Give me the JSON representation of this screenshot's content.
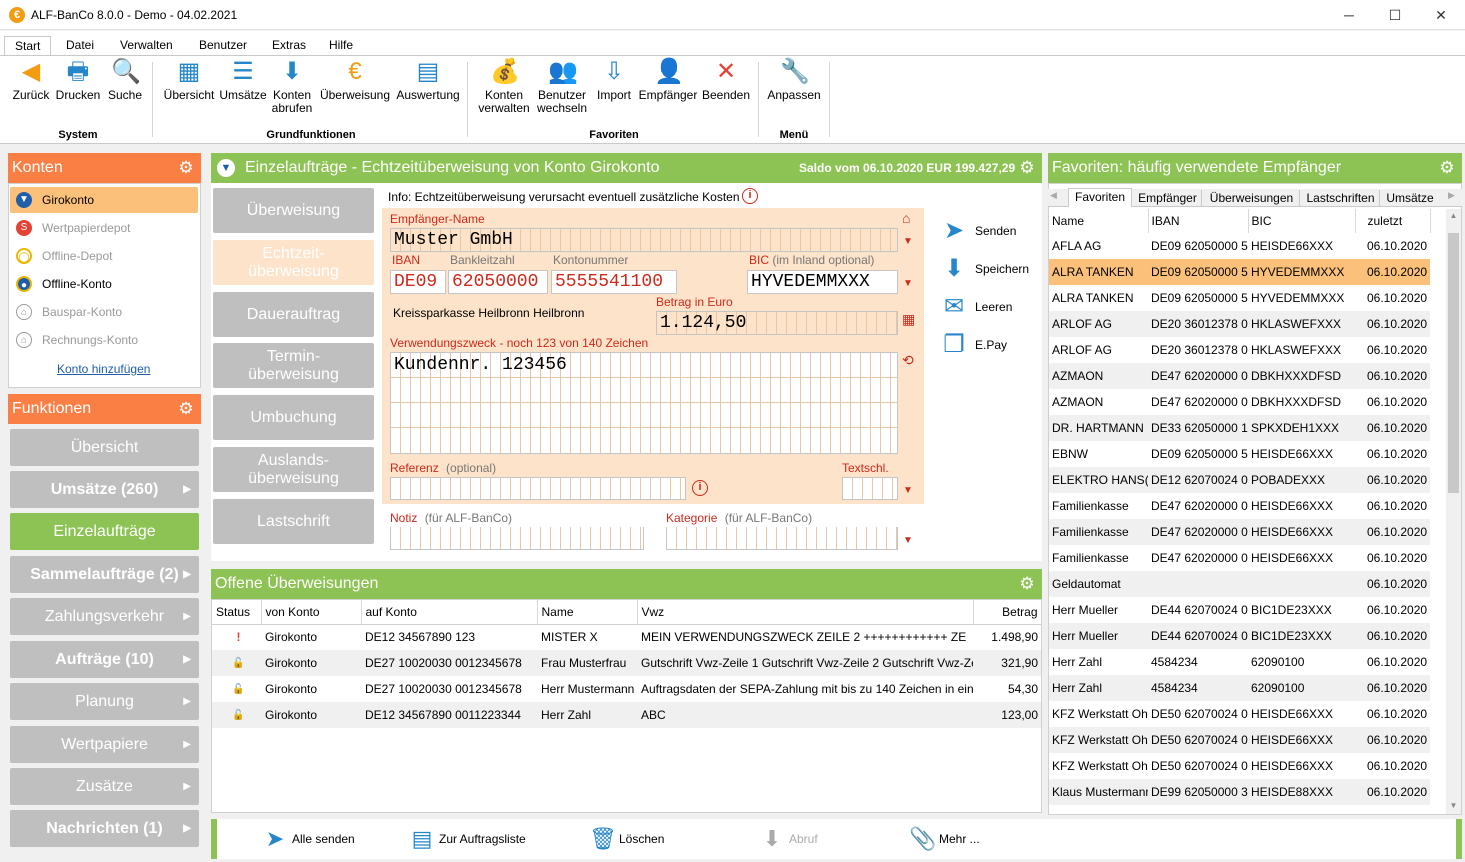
{
  "window": {
    "title": "ALF-BanCo 8.0.0 - Demo  -  04.02.2021",
    "minimize": "─",
    "maximize": "☐",
    "close": "✕"
  },
  "menu": {
    "tabs": [
      "Start",
      "Datei",
      "Verwalten",
      "Benutzer",
      "Extras",
      "Hilfe"
    ]
  },
  "ribbon": {
    "buttons": [
      {
        "label": "Zurück",
        "icon": "arrow-left-icon",
        "glyph": "◀"
      },
      {
        "label": "Drucken",
        "icon": "printer-icon",
        "glyph": "🖶"
      },
      {
        "label": "Suche",
        "icon": "search-icon",
        "glyph": "🔍"
      },
      {
        "label": "Übersicht",
        "icon": "overview-icon",
        "glyph": "▦"
      },
      {
        "label": "Umsätze",
        "icon": "list-icon",
        "glyph": "☰"
      },
      {
        "label": "Konten\nabrufen",
        "icon": "download-icon",
        "glyph": "⬇"
      },
      {
        "label": "Überweisung",
        "icon": "euro-icon",
        "glyph": "€"
      },
      {
        "label": "Auswertung",
        "icon": "document-icon",
        "glyph": "▤"
      },
      {
        "label": "Konten\nverwalten",
        "icon": "money-bag-icon",
        "glyph": "💰"
      },
      {
        "label": "Benutzer\nwechseln",
        "icon": "users-icon",
        "glyph": "👥"
      },
      {
        "label": "Import",
        "icon": "import-icon",
        "glyph": "⇩"
      },
      {
        "label": "Empfänger",
        "icon": "recipient-icon",
        "glyph": "👤"
      },
      {
        "label": "Beenden",
        "icon": "exit-icon",
        "glyph": "✕"
      },
      {
        "label": "Anpassen",
        "icon": "tools-icon",
        "glyph": "🔧"
      }
    ],
    "groups": [
      "System",
      "Grundfunktionen",
      "Favoriten",
      "Menü"
    ]
  },
  "konten": {
    "title": "Konten",
    "items": [
      {
        "label": "Girokonto",
        "active": true,
        "color": "#1f5ea8"
      },
      {
        "label": "Wertpapierdepot",
        "active": false,
        "color": "#e34234"
      },
      {
        "label": "Offline-Depot",
        "active": false,
        "color": "#e8b600"
      },
      {
        "label": "Offline-Konto",
        "active": true,
        "color": "#1f5ea8"
      },
      {
        "label": "Bauspar-Konto",
        "active": false,
        "color": "#9a9a9a"
      },
      {
        "label": "Rechnungs-Konto",
        "active": false,
        "color": "#9a9a9a"
      }
    ],
    "add_link": "Konto hinzufügen"
  },
  "funktionen": {
    "title": "Funktionen",
    "items": [
      {
        "label": "Übersicht",
        "bold": false,
        "arrow": false,
        "active": false
      },
      {
        "label": "Umsätze (260)",
        "bold": true,
        "arrow": true,
        "active": false
      },
      {
        "label": "Einzelaufträge",
        "bold": false,
        "arrow": false,
        "active": true
      },
      {
        "label": "Sammelaufträge (2)",
        "bold": true,
        "arrow": true,
        "active": false
      },
      {
        "label": "Zahlungsverkehr",
        "bold": false,
        "arrow": true,
        "active": false
      },
      {
        "label": "Aufträge (10)",
        "bold": true,
        "arrow": true,
        "active": false
      },
      {
        "label": "Planung",
        "bold": false,
        "arrow": true,
        "active": false
      },
      {
        "label": "Wertpapiere",
        "bold": false,
        "arrow": true,
        "active": false
      },
      {
        "label": "Zusätze",
        "bold": false,
        "arrow": true,
        "active": false
      },
      {
        "label": "Nachrichten (1)",
        "bold": true,
        "arrow": true,
        "active": false
      }
    ]
  },
  "einzel": {
    "title": "Einzelaufträge - Echtzeitüberweisung von Konto Girokonto",
    "saldo": "Saldo vom 06.10.2020 EUR 199.427,29",
    "tabs": [
      "Überweisung",
      "Echtzeit-\nüberweisung",
      "Dauerauftrag",
      "Termin-\nüberweisung",
      "Umbuchung",
      "Auslands-\nüberweisung",
      "Lastschrift"
    ],
    "active_tab": 1,
    "info": "Info: Echtzeitüberweisung verursacht eventuell zusätzliche Kosten",
    "form": {
      "empfaenger_label": "Empfänger-Name",
      "empfaenger": "Muster GmbH",
      "iban_label": "IBAN",
      "blz_label": "Bankleitzahl",
      "kto_label": "Kontonummer",
      "bic_label": "BIC",
      "bic_hint": "(im Inland optional)",
      "iban": "DE09",
      "blz": "62050000",
      "kto": "5555541100",
      "bic": "HYVEDEMMXXX",
      "bank": "Kreissparkasse Heilbronn Heilbronn",
      "betrag_label": "Betrag in Euro",
      "betrag": "1.124,50",
      "vz_label": "Verwendungszweck - noch 123 von 140 Zeichen",
      "vz": "Kundennr. 123456",
      "referenz_label": "Referenz",
      "referenz_hint": "(optional)",
      "textschl_label": "Textschl.",
      "notiz_label": "Notiz",
      "notiz_hint": "(für ALF-BanCo)",
      "kategorie_label": "Kategorie",
      "kategorie_hint": "(für ALF-BanCo)"
    },
    "actions": [
      "Senden",
      "Speichern",
      "Leeren",
      "E.Pay"
    ]
  },
  "offene": {
    "title": "Offene Überweisungen",
    "columns": [
      "Status",
      "von Konto",
      "auf Konto",
      "Name",
      "Vwz",
      "Betrag"
    ],
    "rows": [
      {
        "status": "!",
        "von": "Girokonto",
        "auf": "DE12 34567890 123",
        "name": "MISTER X",
        "vwz": "MEIN VERWENDUNGSZWECK ZEILE 2 ++++++++++++ ZE",
        "betrag": "1.498,90"
      },
      {
        "status": "🔓",
        "von": "Girokonto",
        "auf": "DE27 10020030 0012345678",
        "name": "Frau Musterfrau",
        "vwz": "Gutschrift Vwz-Zeile 1 Gutschrift Vwz-Zeile 2 Gutschrift Vwz-Ze",
        "betrag": "321,90"
      },
      {
        "status": "🔓",
        "von": "Girokonto",
        "auf": "DE27 10020030 0012345678",
        "name": "Herr Mustermann",
        "vwz": "Auftragsdaten der SEPA-Zahlung mit bis zu 140 Zeichen in ein",
        "betrag": "54,30"
      },
      {
        "status": "🔓",
        "von": "Girokonto",
        "auf": "DE12 34567890 0011223344",
        "name": "Herr Zahl",
        "vwz": "ABC",
        "betrag": "123,00"
      }
    ]
  },
  "favoriten": {
    "title": "Favoriten: häufig verwendete Empfänger",
    "tabs": [
      "Favoriten",
      "Empfänger",
      "Überweisungen",
      "Lastschriften",
      "Umsätze"
    ],
    "columns": [
      "Name",
      "IBAN",
      "BIC",
      "zuletzt"
    ],
    "rows": [
      {
        "name": "AFLA AG",
        "iban": "DE09 62050000 5",
        "bic": "HEISDE66XXX",
        "date": "06.10.2020"
      },
      {
        "name": "ALRA TANKEN",
        "iban": "DE09 62050000 5",
        "bic": "HYVEDEMMXXX",
        "date": "06.10.2020"
      },
      {
        "name": "ALRA TANKEN",
        "iban": "DE09 62050000 5",
        "bic": "HYVEDEMMXXX",
        "date": "06.10.2020"
      },
      {
        "name": "ARLOF AG",
        "iban": "DE20 36012378 0",
        "bic": "HKLASWEFXXX",
        "date": "06.10.2020"
      },
      {
        "name": "ARLOF AG",
        "iban": "DE20 36012378 0",
        "bic": "HKLASWEFXXX",
        "date": "06.10.2020"
      },
      {
        "name": "AZMAON",
        "iban": "DE47 62020000 0",
        "bic": "DBKHXXXDFSD",
        "date": "06.10.2020"
      },
      {
        "name": "AZMAON",
        "iban": "DE47 62020000 0",
        "bic": "DBKHXXXDFSD",
        "date": "06.10.2020"
      },
      {
        "name": "DR. HARTMANN",
        "iban": "DE33 62050000 1",
        "bic": "SPKXDEH1XXX",
        "date": "06.10.2020"
      },
      {
        "name": "EBNW",
        "iban": "DE09 62050000 5",
        "bic": "HEISDE66XXX",
        "date": "06.10.2020"
      },
      {
        "name": "ELEKTRO HANS(",
        "iban": "DE12 62070024 0",
        "bic": "POBADEXXX",
        "date": "06.10.2020"
      },
      {
        "name": "Familienkasse",
        "iban": "DE47 62020000 0",
        "bic": "HEISDE66XXX",
        "date": "06.10.2020"
      },
      {
        "name": "Familienkasse",
        "iban": "DE47 62020000 0",
        "bic": "HEISDE66XXX",
        "date": "06.10.2020"
      },
      {
        "name": "Familienkasse",
        "iban": "DE47 62020000 0",
        "bic": "HEISDE66XXX",
        "date": "06.10.2020"
      },
      {
        "name": "Geldautomat",
        "iban": "",
        "bic": "",
        "date": "06.10.2020"
      },
      {
        "name": "Herr Mueller",
        "iban": "DE44 62070024 0",
        "bic": "BIC1DE23XXX",
        "date": "06.10.2020"
      },
      {
        "name": "Herr Mueller",
        "iban": "DE44 62070024 0",
        "bic": "BIC1DE23XXX",
        "date": "06.10.2020"
      },
      {
        "name": "Herr Zahl",
        "iban": "4584234",
        "bic": "62090100",
        "date": "06.10.2020"
      },
      {
        "name": "Herr Zahl",
        "iban": "4584234",
        "bic": "62090100",
        "date": "06.10.2020"
      },
      {
        "name": "KFZ Werkstatt Oh",
        "iban": "DE50 62070024 0",
        "bic": "HEISDE66XXX",
        "date": "06.10.2020"
      },
      {
        "name": "KFZ Werkstatt Oh",
        "iban": "DE50 62070024 0",
        "bic": "HEISDE66XXX",
        "date": "06.10.2020"
      },
      {
        "name": "KFZ Werkstatt Oh",
        "iban": "DE50 62070024 0",
        "bic": "HEISDE66XXX",
        "date": "06.10.2020"
      },
      {
        "name": "Klaus Mustermann",
        "iban": "DE99 62050000 3",
        "bic": "HEISDE88XXX",
        "date": "06.10.2020"
      }
    ],
    "selected": 1
  },
  "bottom": {
    "buttons": [
      {
        "label": "Alle senden",
        "glyph": "➤",
        "disabled": false,
        "icon": "send-all-icon"
      },
      {
        "label": "Zur Auftragsliste",
        "glyph": "▤",
        "disabled": false,
        "icon": "order-list-icon"
      },
      {
        "label": "Löschen",
        "glyph": "🗑",
        "disabled": false,
        "icon": "trash-icon"
      },
      {
        "label": "Abruf",
        "glyph": "⬇",
        "disabled": true,
        "icon": "fetch-icon"
      },
      {
        "label": "Mehr ...",
        "glyph": "📎",
        "disabled": false,
        "icon": "attachment-icon"
      }
    ]
  }
}
